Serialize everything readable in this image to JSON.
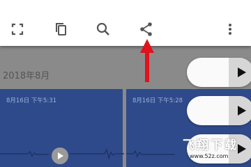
{
  "toolbar": {
    "icons": [
      "fullscreen-icon",
      "copy-icon",
      "search-icon",
      "share-icon",
      "more-vert-icon"
    ]
  },
  "month_header": "2018年8月",
  "recordings": [
    {
      "date": "8月16日 下午5:31"
    },
    {
      "date": "8月16日 下午5:28"
    }
  ],
  "watermark": {
    "title": "飞翔下载",
    "url": "www.52z.com"
  },
  "colors": {
    "card": "#2f4a8a",
    "arrow": "#e0121b",
    "background": "#8a8a8a"
  }
}
